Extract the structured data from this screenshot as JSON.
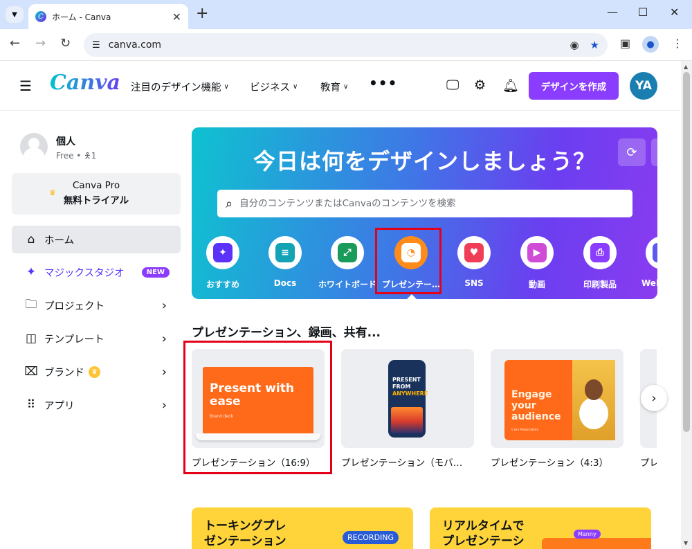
{
  "browser": {
    "tab_title": "ホーム - Canva",
    "url": "canva.com"
  },
  "header": {
    "logo": "Canva",
    "nav": [
      {
        "label": "注目のデザイン機能"
      },
      {
        "label": "ビジネス"
      },
      {
        "label": "教育"
      }
    ],
    "create_button": "デザインを作成",
    "avatar_initials": "YA"
  },
  "sidebar": {
    "user_name": "個人",
    "user_plan": "Free • 🯅1",
    "pro_title": "Canva Pro",
    "pro_sub": "無料トライアル",
    "items": [
      {
        "label": "ホーム",
        "icon": "home-icon"
      },
      {
        "label": "マジックスタジオ",
        "icon": "sparkle-icon",
        "badge": "NEW"
      },
      {
        "label": "プロジェクト",
        "icon": "folder-icon"
      },
      {
        "label": "テンプレート",
        "icon": "template-icon"
      },
      {
        "label": "ブランド",
        "icon": "brand-icon"
      },
      {
        "label": "アプリ",
        "icon": "apps-grid-icon"
      }
    ]
  },
  "hero": {
    "title": "今日は何をデザインしましょう？",
    "search_placeholder": "自分のコンテンツまたはCanvaのコンテンツを検索",
    "categories": [
      {
        "label": "おすすめ",
        "icon": "sparkles-icon",
        "color": "#5a32fa"
      },
      {
        "label": "Docs",
        "icon": "docs-icon",
        "color": "#13a3b5"
      },
      {
        "label": "ホワイトボード",
        "icon": "whiteboard-icon",
        "color": "#1a9b5a"
      },
      {
        "label": "プレゼンテー…",
        "icon": "presentation-icon",
        "color": "#ff8c1a"
      },
      {
        "label": "SNS",
        "icon": "heart-icon",
        "color": "#ef3e55"
      },
      {
        "label": "動画",
        "icon": "video-icon",
        "color": "#d04bd6"
      },
      {
        "label": "印刷製品",
        "icon": "printer-icon",
        "color": "#8b3dff"
      },
      {
        "label": "Web",
        "icon": "web-icon",
        "color": "#5a5af0"
      }
    ]
  },
  "section": {
    "title": "プレゼンテーション、録画、共有...",
    "cards": [
      {
        "caption": "プレゼンテーション（16:9）",
        "thumb_text": "Present with ease",
        "thumb_sub": "Brand deck"
      },
      {
        "caption": "プレゼンテーション（モバ…",
        "thumb_text_1": "PRESENT FROM",
        "thumb_text_2": "ANYWHERE"
      },
      {
        "caption": "プレゼンテーション（4:3）",
        "thumb_text": "Engage your audience",
        "thumb_sub": "Cars Associates"
      },
      {
        "caption": "プレ"
      }
    ]
  },
  "bottom_cards": [
    {
      "title_1": "トーキングプレ",
      "title_2": "ゼンテーション",
      "badge": "RECORDING"
    },
    {
      "title_1": "リアルタイムで",
      "title_2": "プレゼンテーシ",
      "badge": "Manny"
    }
  ],
  "colors": {
    "accent": "#8b3dff",
    "highlight": "#e5001a"
  }
}
